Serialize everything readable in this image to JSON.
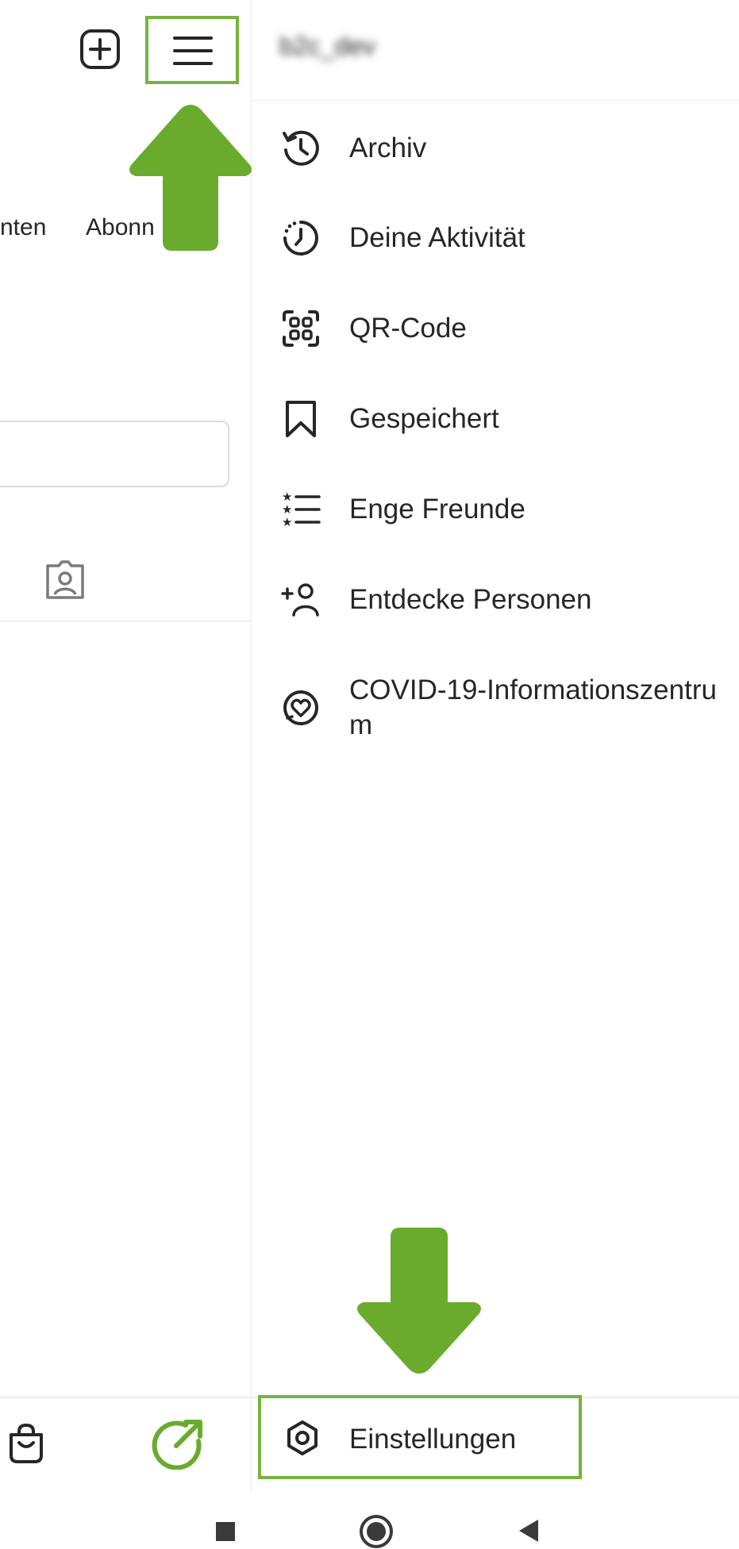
{
  "header": {
    "username_blurred": "b2c_dev",
    "add_icon": "plus-square-icon",
    "menu_icon": "hamburger-menu-icon"
  },
  "profile": {
    "stat_labels": [
      "nten",
      "Abonn"
    ]
  },
  "menu": {
    "items": [
      {
        "label": "Archiv",
        "icon": "archive-history-icon"
      },
      {
        "label": "Deine Aktivität",
        "icon": "activity-clock-icon"
      },
      {
        "label": "QR-Code",
        "icon": "qr-code-icon"
      },
      {
        "label": "Gespeichert",
        "icon": "bookmark-icon"
      },
      {
        "label": "Enge Freunde",
        "icon": "close-friends-list-icon"
      },
      {
        "label": "Entdecke Personen",
        "icon": "add-person-icon"
      },
      {
        "label": "COVID-19-Informationszentrum",
        "icon": "covid-info-heart-icon"
      }
    ],
    "settings_label": "Einstellungen"
  },
  "bottom_nav": {
    "shop_icon": "shopping-bag-icon",
    "profile_icon": "profile-arrow-icon"
  },
  "colors": {
    "accent_green": "#6aab2e",
    "highlight_border": "#76b33f",
    "text": "#262626"
  }
}
